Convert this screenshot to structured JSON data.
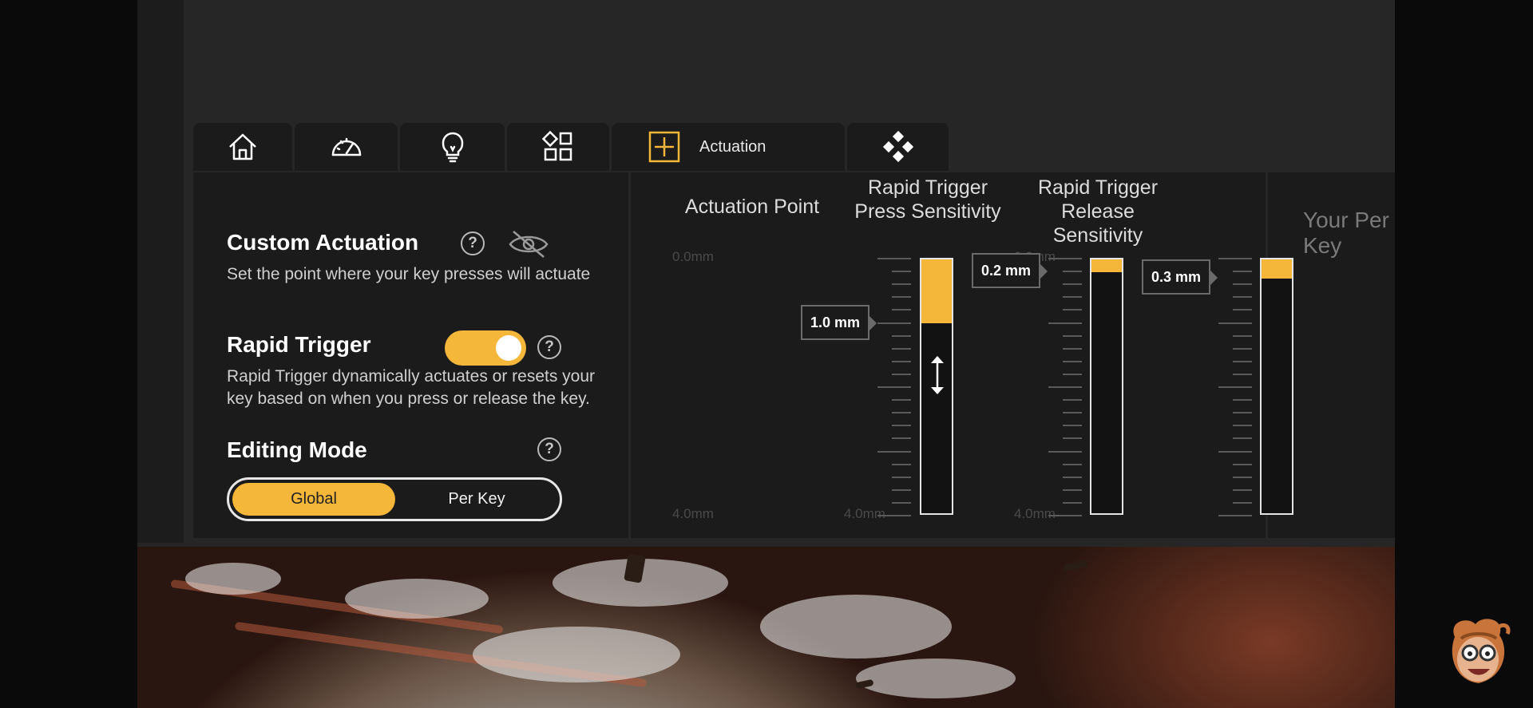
{
  "tabs": [
    {
      "icon": "home-icon",
      "label": ""
    },
    {
      "icon": "speedometer-icon",
      "label": ""
    },
    {
      "icon": "lightbulb-icon",
      "label": ""
    },
    {
      "icon": "shapes-icon",
      "label": ""
    },
    {
      "icon": "actuation-icon",
      "label": "Actuation",
      "active": true
    },
    {
      "icon": "diamond-grid-icon",
      "label": ""
    }
  ],
  "custom_actuation": {
    "title": "Custom Actuation",
    "help": "?",
    "description": "Set the point where your key presses will actuate"
  },
  "rapid_trigger": {
    "title": "Rapid Trigger",
    "help": "?",
    "enabled": true,
    "description": "Rapid Trigger dynamically actuates or resets your key based on when you press or release the key."
  },
  "editing_mode": {
    "title": "Editing Mode",
    "help": "?",
    "options": [
      "Global",
      "Per Key"
    ],
    "selected": "Global"
  },
  "sliders": [
    {
      "title": "Actuation Point",
      "value_label": "1.0 mm",
      "value": 1.0,
      "min_label": "0.0mm",
      "max_label": "4.0mm"
    },
    {
      "title": "Rapid Trigger Press Sensitivity",
      "value_label": "0.2 mm",
      "value": 0.2,
      "min_label": "",
      "max_label": "4.0mm"
    },
    {
      "title": "Rapid Trigger Release Sensitivity",
      "value_label": "0.3 mm",
      "value": 0.3,
      "min_label": "0.0mm",
      "max_label": "4.0mm"
    }
  ],
  "per_key_heading": "Your Per Key",
  "colors": {
    "accent": "#f5b73a",
    "panel": "#1b1b1b",
    "frame": "#262626"
  }
}
